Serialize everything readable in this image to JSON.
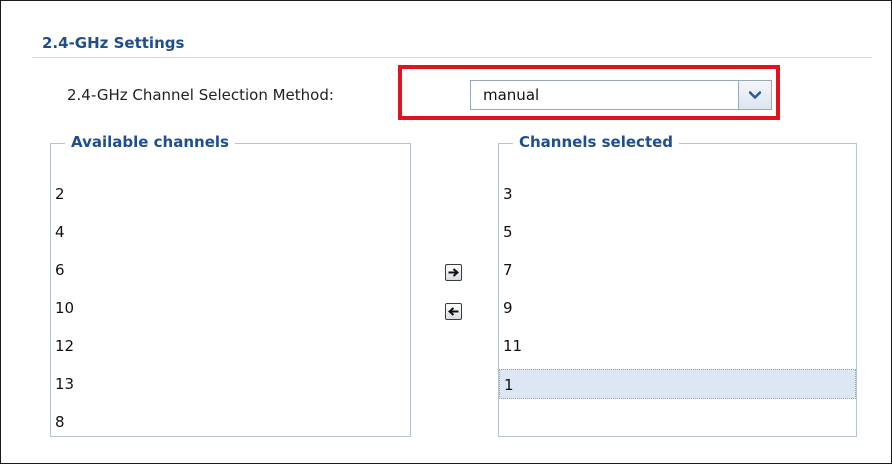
{
  "section": {
    "title": "2.4-GHz Settings"
  },
  "method": {
    "label": "2.4-GHz Channel Selection Method:",
    "value": "manual"
  },
  "available": {
    "legend": "Available channels",
    "items": [
      "2",
      "4",
      "6",
      "10",
      "12",
      "13",
      "8"
    ]
  },
  "selected": {
    "legend": "Channels selected",
    "items": [
      "3",
      "5",
      "7",
      "9",
      "11",
      "1"
    ],
    "highlighted_value": "1"
  },
  "icons": {
    "dropdown": "chevron-down-icon",
    "add": "arrow-right-icon",
    "remove": "arrow-left-icon"
  },
  "colors": {
    "heading": "#1f4e8c",
    "highlight_border": "#e0141e",
    "selected_row": "#dde6f3"
  }
}
